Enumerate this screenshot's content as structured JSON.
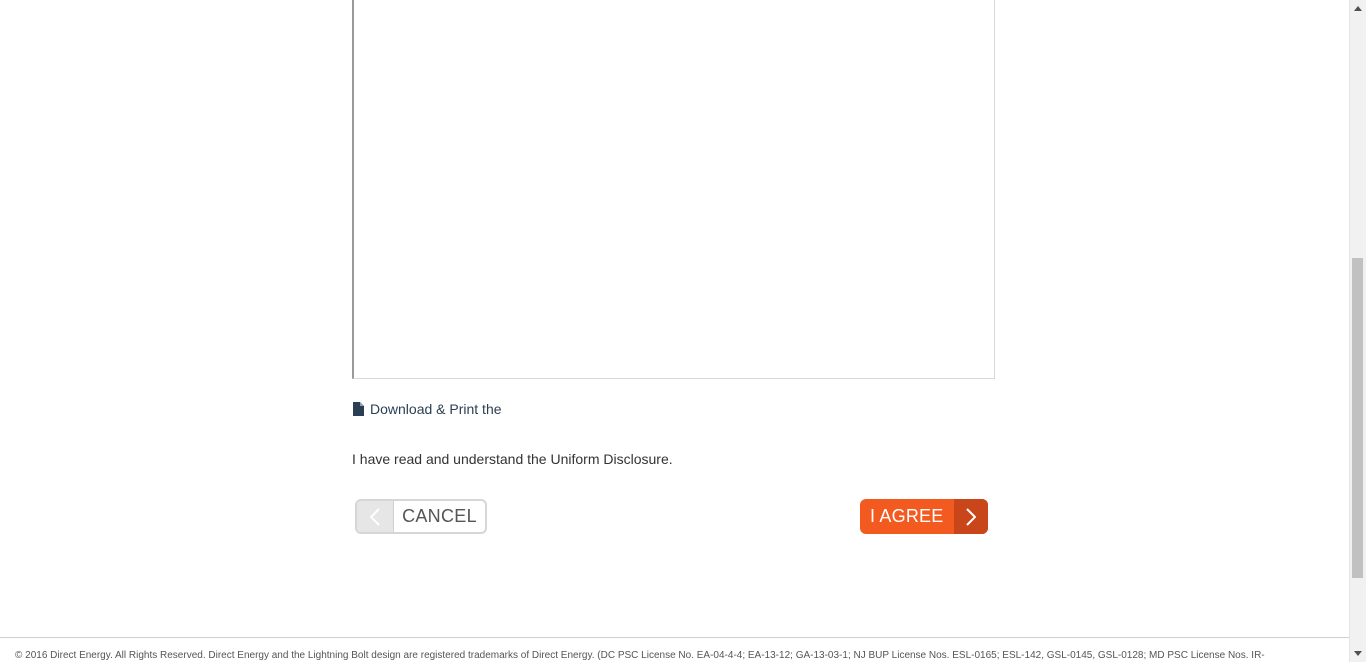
{
  "document": {
    "download_link_label": "Download & Print the",
    "agree_statement": "I have read and understand the Uniform Disclosure."
  },
  "actions": {
    "cancel_label": "CANCEL",
    "agree_label": "I AGREE"
  },
  "footer": {
    "copyright": "© 2016 Direct Energy. All Rights Reserved. Direct Energy and the Lightning Bolt design are registered trademarks of Direct Energy. (DC PSC License No. EA-04-4-4; EA-13-12; GA-13-03-1; NJ BUP License Nos. ESL-0165; ESL-142, GSL-0145, GSL-0128; MD PSC License Nos. IR-"
  },
  "colors": {
    "agree_button": "#f25a1f",
    "agree_button_dark": "#c8461a",
    "link_text": "#2a3f54"
  },
  "icons": {
    "download": "document-icon",
    "cancel": "chevron-left-icon",
    "agree": "chevron-right-icon"
  },
  "scroll": {
    "position_fraction": 0.82
  }
}
